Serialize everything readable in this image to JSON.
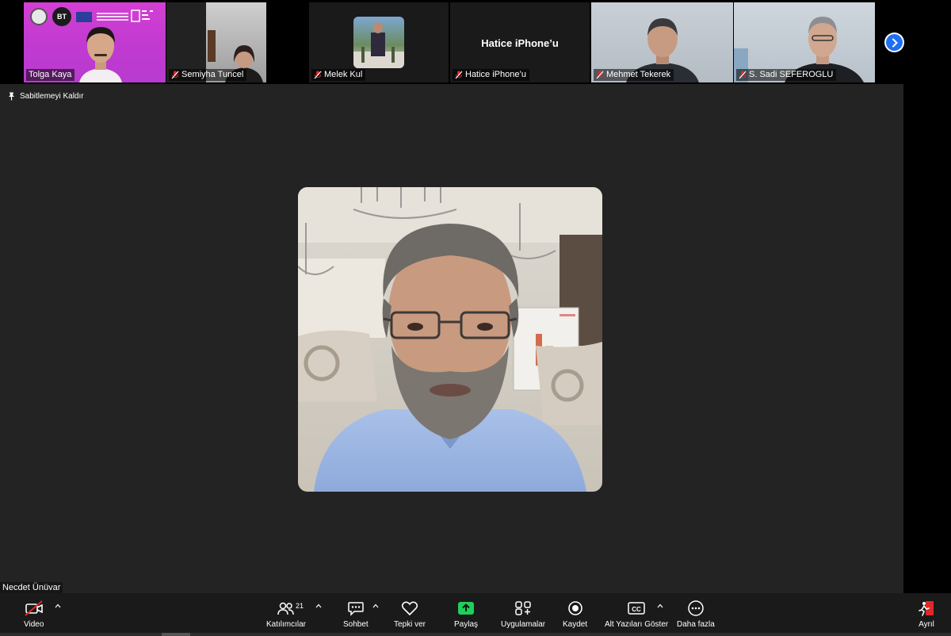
{
  "participants": [
    {
      "name": "Tolga Kaya",
      "muted": false
    },
    {
      "name": "Semiyha Tuncel",
      "muted": true
    },
    {
      "name": "Melek Kul",
      "muted": true
    },
    {
      "name": "Hatice iPhone’u",
      "muted": true,
      "display_text": "Hatice iPhone’u"
    },
    {
      "name": "Mehmet Tekerek",
      "muted": true
    },
    {
      "name": "S. Sadi SEFEROGLU",
      "muted": true
    }
  ],
  "strip_logo_text": "BT",
  "unpin_label": "Sabitlemeyi Kaldır",
  "main_speaker": "Necdet Ünüvar",
  "toolbar": {
    "video": "Video",
    "participants": "Katılımcılar",
    "participant_count": "21",
    "chat": "Sohbet",
    "react": "Tepki ver",
    "share": "Paylaş",
    "apps": "Uygulamalar",
    "record": "Kaydet",
    "captions": "Alt Yazıları Göster",
    "more": "Daha fazla",
    "leave": "Ayrıl"
  },
  "colors": {
    "stage": "#232323",
    "toolbar": "#1a1a1a",
    "share_green": "#1fcf5b",
    "next_blue": "#1e6ff2",
    "mute_red": "#e02828"
  }
}
